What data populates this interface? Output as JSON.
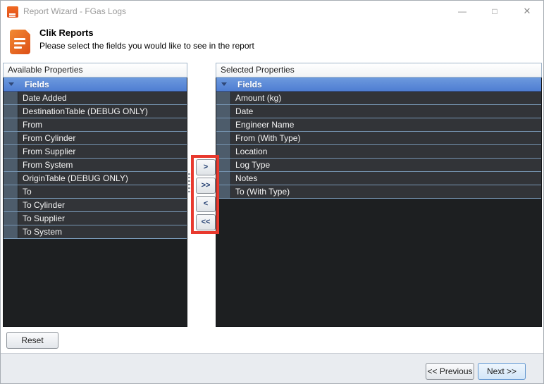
{
  "window": {
    "title": "Report Wizard - FGas Logs",
    "controls": {
      "minimize": "—",
      "maximize": "□",
      "close": "✕"
    }
  },
  "header": {
    "title": "Clik Reports",
    "subtitle": "Please select the fields you would like to see in the report"
  },
  "available_panel": {
    "header": "Available Properties",
    "group": "Fields",
    "items": [
      "Date Added",
      "DestinationTable (DEBUG ONLY)",
      "From",
      "From Cylinder",
      "From Supplier",
      "From System",
      "OriginTable (DEBUG ONLY)",
      "To",
      "To Cylinder",
      "To Supplier",
      "To System"
    ]
  },
  "selected_panel": {
    "header": "Selected Properties",
    "group": "Fields",
    "items": [
      "Amount (kg)",
      "Date",
      "Engineer Name",
      "From (With Type)",
      "Location",
      "Log Type",
      "Notes",
      "To (With Type)"
    ]
  },
  "transfer": {
    "move_right": ">",
    "move_all_right": ">>",
    "move_left": "<",
    "move_all_left": "<<"
  },
  "footer": {
    "reset": "Reset",
    "previous": "<< Previous",
    "next": "Next >>"
  },
  "colors": {
    "accent_blue": "#5b8dd6",
    "row_background": "#323438",
    "indent_strip": "#4d5c6b",
    "annotation_red": "#e8392e",
    "icon_orange": "#e8511f"
  }
}
